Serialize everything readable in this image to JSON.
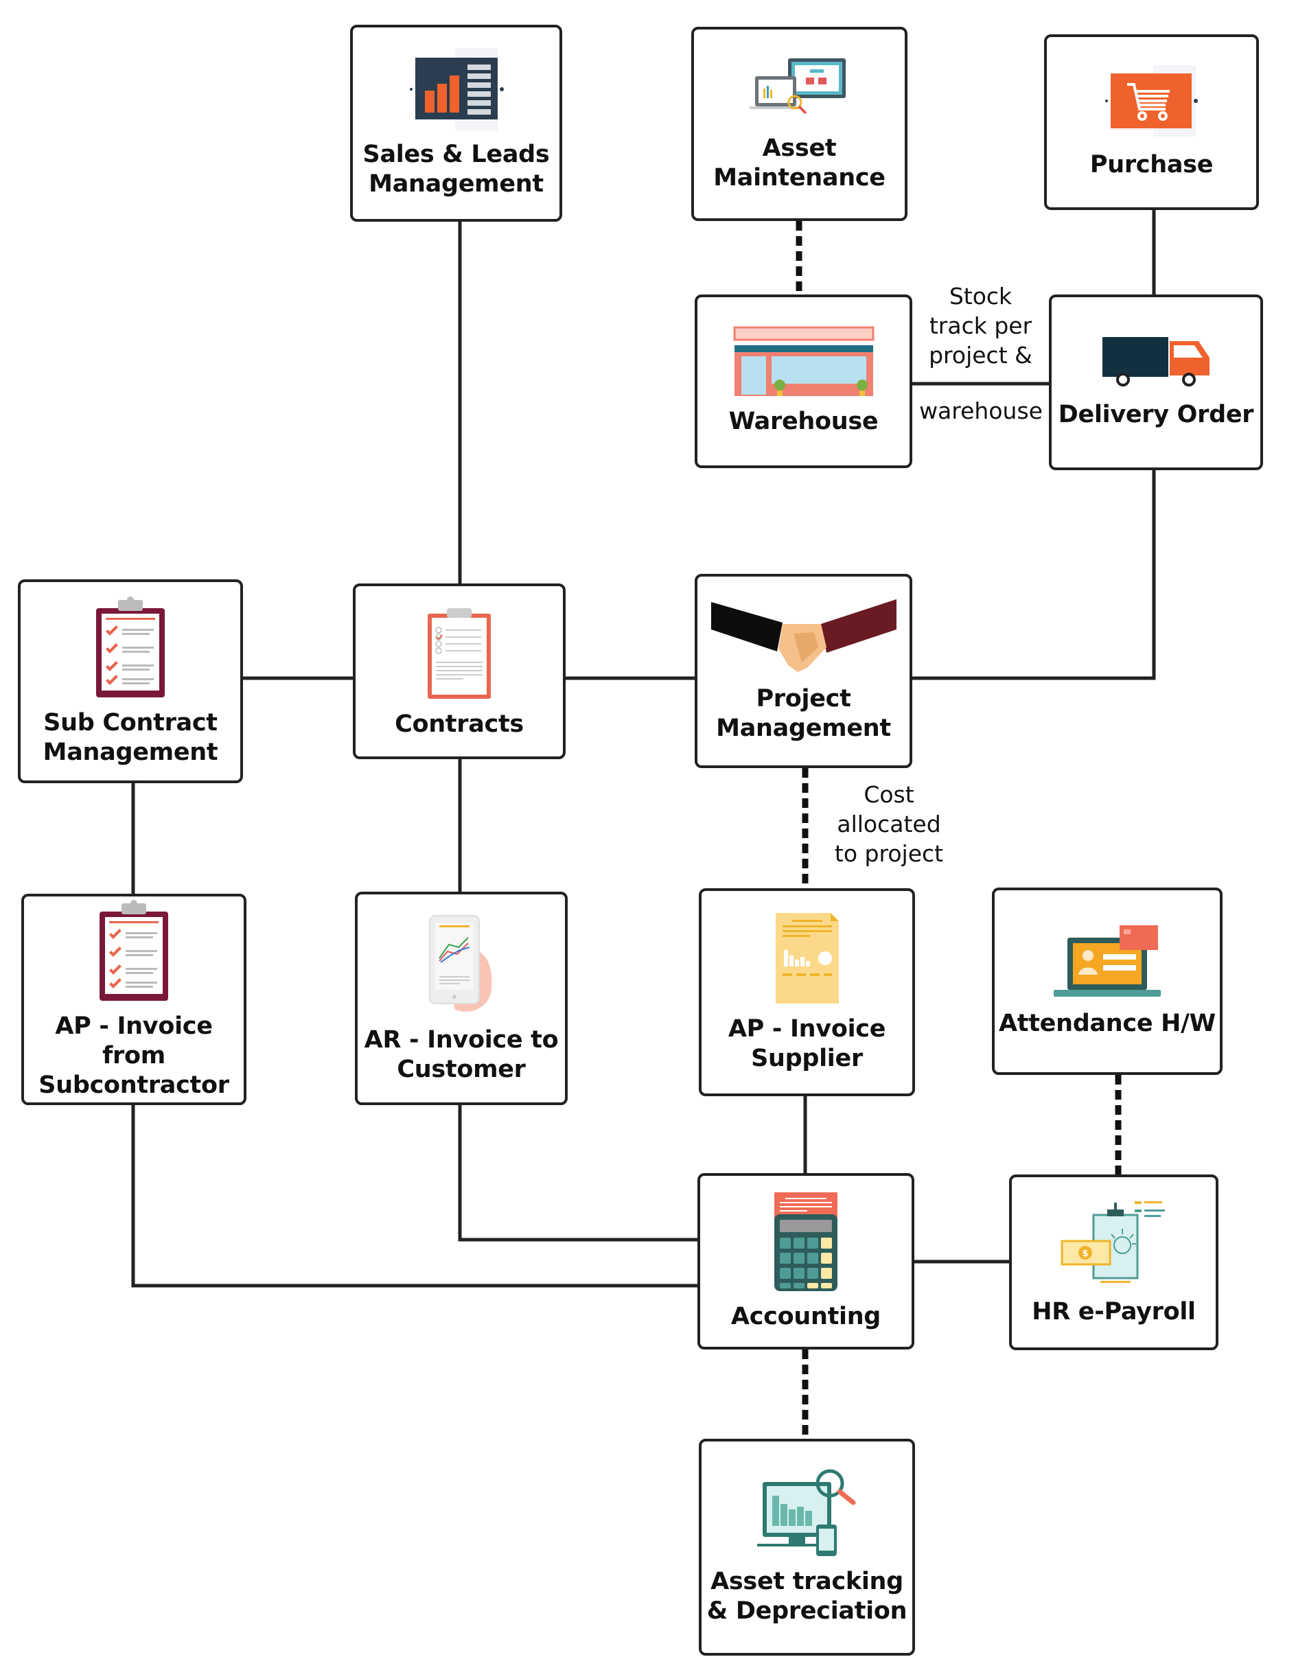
{
  "nodes": {
    "sales": {
      "label": "Sales & Leads\nManagement",
      "icon": "bar-chart-icon"
    },
    "asset_maintenance": {
      "label": "Asset\nMaintenance",
      "icon": "computer-screens-icon"
    },
    "purchase": {
      "label": "Purchase",
      "icon": "shopping-cart-icon"
    },
    "warehouse": {
      "label": "Warehouse",
      "icon": "storefront-icon"
    },
    "delivery_order": {
      "label": "Delivery Order",
      "icon": "truck-icon"
    },
    "sub_contract": {
      "label": "Sub Contract\nManagement",
      "icon": "checklist-clipboard-icon"
    },
    "contracts": {
      "label": "Contracts",
      "icon": "clipboard-icon"
    },
    "project_management": {
      "label": "Project\nManagement",
      "icon": "handshake-icon"
    },
    "ap_invoice_subcontractor": {
      "label": "AP - Invoice from\nSubcontractor",
      "icon": "checklist-clipboard-icon"
    },
    "ar_invoice_customer": {
      "label": "AR - Invoice to\nCustomer",
      "icon": "tablet-chart-icon"
    },
    "ap_invoice_supplier": {
      "label": "AP - Invoice\nSupplier",
      "icon": "invoice-document-icon"
    },
    "attendance": {
      "label": "Attendance H/W",
      "icon": "laptop-profile-icon"
    },
    "accounting": {
      "label": "Accounting",
      "icon": "calculator-icon"
    },
    "hr_payroll": {
      "label": "HR e-Payroll",
      "icon": "payroll-icon"
    },
    "asset_tracking": {
      "label": "Asset tracking\n& Depreciation",
      "icon": "monitor-magnifier-icon"
    }
  },
  "notes": {
    "stock_top": "Stock\ntrack per\nproject &",
    "stock_bottom": "warehouse",
    "cost": "Cost\nallocated\nto project"
  },
  "connections": [
    {
      "from": "sales",
      "to": "contracts",
      "style": "solid"
    },
    {
      "from": "sub_contract",
      "to": "contracts",
      "style": "solid"
    },
    {
      "from": "contracts",
      "to": "project_management",
      "style": "solid"
    },
    {
      "from": "project_management",
      "to": "delivery_order",
      "style": "solid"
    },
    {
      "from": "purchase",
      "to": "delivery_order",
      "style": "solid"
    },
    {
      "from": "warehouse",
      "to": "delivery_order",
      "style": "solid",
      "note": "Stock track per project & warehouse"
    },
    {
      "from": "asset_maintenance",
      "to": "warehouse",
      "style": "dashed"
    },
    {
      "from": "project_management",
      "to": "ap_invoice_supplier",
      "style": "dashed",
      "note": "Cost allocated to project"
    },
    {
      "from": "sub_contract",
      "to": "ap_invoice_subcontractor",
      "style": "solid"
    },
    {
      "from": "contracts",
      "to": "ar_invoice_customer",
      "style": "solid"
    },
    {
      "from": "ap_invoice_supplier",
      "to": "accounting",
      "style": "solid"
    },
    {
      "from": "ar_invoice_customer",
      "to": "accounting",
      "style": "solid"
    },
    {
      "from": "ap_invoice_subcontractor",
      "to": "accounting",
      "style": "solid"
    },
    {
      "from": "accounting",
      "to": "hr_payroll",
      "style": "solid"
    },
    {
      "from": "attendance",
      "to": "hr_payroll",
      "style": "dashed"
    },
    {
      "from": "accounting",
      "to": "asset_tracking",
      "style": "dashed"
    }
  ],
  "colors": {
    "line": "#222222",
    "orange": "#f0622d",
    "navy": "#2b3e50",
    "maroon": "#7a1838",
    "coral": "#e8664f",
    "teal": "#3f8a80",
    "yellow": "#fcd98a"
  }
}
